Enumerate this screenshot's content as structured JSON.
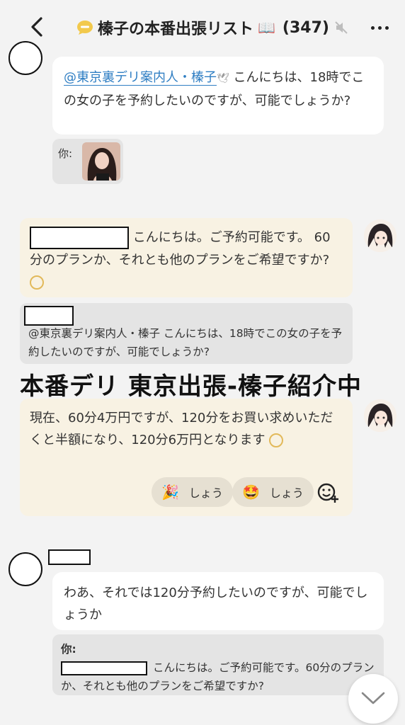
{
  "header": {
    "title": "榛子の本番出張リスト",
    "book_emoji": "📖",
    "member_count": "(347)"
  },
  "messages": [
    {
      "mention": "@東京裏デリ案内人・榛子",
      "text": "こんにちは、18時でこの女の子を予約したいのですが、可能でしょうか?",
      "attachment_label": "你:"
    },
    {
      "text_line1": "こんにちは。ご予約可能です。",
      "text_rest": "60分のプランか、それとも他のプランをご希望ですか?",
      "quote_text": "@東京裏デリ案内人・榛子 こんにちは、18時でこの女の子を予約したいのですが、可能でしょうか?"
    },
    {
      "text": "現在、60分4万円ですが、120分をお買い求めいただくと半額になり、120分6万円となります",
      "reactions": [
        {
          "emoji": "🎉",
          "label": "しょう"
        },
        {
          "emoji": "🤩",
          "label": "しょう"
        }
      ]
    },
    {
      "text": "わあ、それでは120分予約したいのですが、可能でしょうか",
      "quote_label": "你:",
      "quote_text": "こんにちは。ご予約可能です。60分のプランか、それとも他のプランをご希望ですか?"
    }
  ],
  "overlay_caption": "本番デリ 東京出張-榛子紹介中"
}
